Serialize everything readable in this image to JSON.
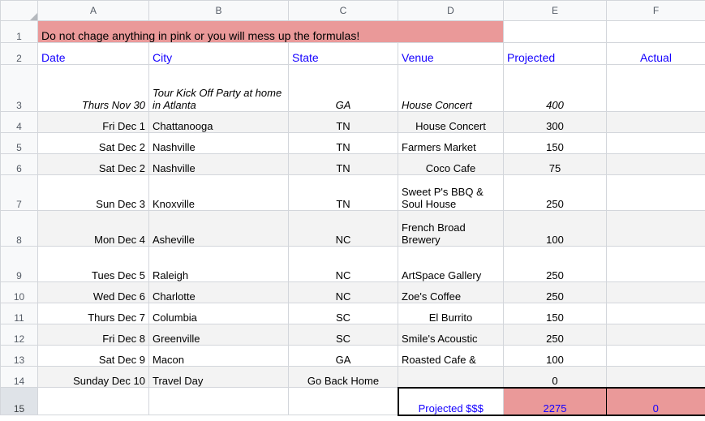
{
  "app": {
    "type": "spreadsheet"
  },
  "columns": [
    "A",
    "B",
    "C",
    "D",
    "E",
    "F"
  ],
  "row_numbers": [
    "1",
    "2",
    "3",
    "4",
    "5",
    "6",
    "7",
    "8",
    "9",
    "10",
    "11",
    "12",
    "13",
    "14",
    "15"
  ],
  "selected_row": "15",
  "colors": {
    "pink": "#ea9999",
    "header_blue": "#1400ff",
    "row_shade": "#f3f3f3",
    "grid_line": "#d3d6db",
    "header_bg": "#f8f9fa",
    "selected_row_header_bg": "#dfe3e8"
  },
  "banner": {
    "text": "Do not chage anything in pink or you will mess up the formulas!"
  },
  "headers": {
    "date": "Date",
    "city": "City",
    "state": "State",
    "venue": "Venue",
    "projected": "Projected",
    "actual": "Actual"
  },
  "rows": [
    {
      "num": "3",
      "date": "Thurs Nov 30",
      "city": "Tour Kick Off Party at home in Atlanta",
      "state": "GA",
      "venue": "House Concert",
      "projected": "400",
      "actual": "",
      "style": "bold-italic"
    },
    {
      "num": "4",
      "date": "Fri Dec 1",
      "city": "Chattanooga",
      "state": "TN",
      "venue": "House Concert",
      "projected": "300",
      "actual": ""
    },
    {
      "num": "5",
      "date": "Sat Dec 2",
      "city": "Nashville",
      "state": "TN",
      "venue": "Farmers Market",
      "projected": "150",
      "actual": ""
    },
    {
      "num": "6",
      "date": "Sat Dec 2",
      "city": "Nashville",
      "state": "TN",
      "venue": "Coco Cafe",
      "projected": "75",
      "actual": ""
    },
    {
      "num": "7",
      "date": "Sun Dec 3",
      "city": "Knoxville",
      "state": "TN",
      "venue": "Sweet P's BBQ & Soul House",
      "projected": "250",
      "actual": ""
    },
    {
      "num": "8",
      "date": "Mon Dec 4",
      "city": "Asheville",
      "state": "NC",
      "venue": "French Broad Brewery",
      "projected": "100",
      "actual": ""
    },
    {
      "num": "9",
      "date": "Tues Dec 5",
      "city": "Raleigh",
      "state": "NC",
      "venue": "ArtSpace Gallery",
      "projected": "250",
      "actual": ""
    },
    {
      "num": "10",
      "date": "Wed Dec 6",
      "city": "Charlotte",
      "state": "NC",
      "venue": "Zoe's Coffee",
      "projected": "250",
      "actual": ""
    },
    {
      "num": "11",
      "date": "Thurs Dec 7",
      "city": "Columbia",
      "state": "SC",
      "venue": "El Burrito",
      "projected": "150",
      "actual": ""
    },
    {
      "num": "12",
      "date": "Fri Dec 8",
      "city": "Greenville",
      "state": "SC",
      "venue": "Smile's Acoustic",
      "projected": "250",
      "actual": ""
    },
    {
      "num": "13",
      "date": "Sat Dec 9",
      "city": "Macon",
      "state": "GA",
      "venue": "Roasted Cafe &",
      "projected": "100",
      "actual": ""
    },
    {
      "num": "14",
      "date": "Sunday Dec 10",
      "city": "Travel Day",
      "state": "Go Back Home",
      "venue": "",
      "projected": "0",
      "actual": ""
    }
  ],
  "total_row": {
    "num": "15",
    "label": "Projected $$$",
    "projected": "2275",
    "actual": "0"
  }
}
